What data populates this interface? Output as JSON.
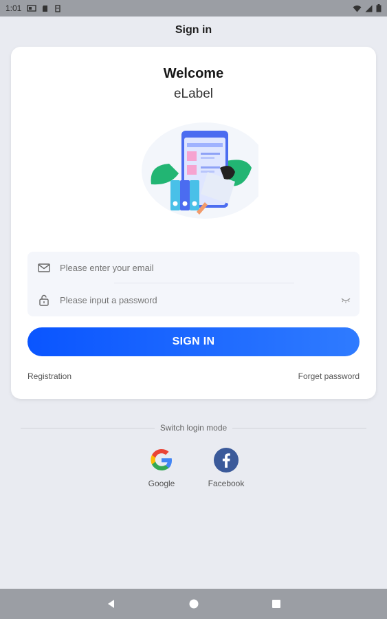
{
  "status_bar": {
    "time": "1:01"
  },
  "header": {
    "title": "Sign in"
  },
  "card": {
    "welcome": "Welcome",
    "app_name": "eLabel"
  },
  "form": {
    "email_placeholder": "Please enter your email",
    "password_placeholder": "Please input a password"
  },
  "actions": {
    "sign_in": "SIGN IN",
    "registration": "Registration",
    "forget_password": "Forget password"
  },
  "login_modes": {
    "label": "Switch login mode",
    "google": "Google",
    "facebook": "Facebook"
  },
  "colors": {
    "accent": "#0a55ff",
    "background": "#e9ebf1",
    "illustration_green": "#22b573"
  }
}
